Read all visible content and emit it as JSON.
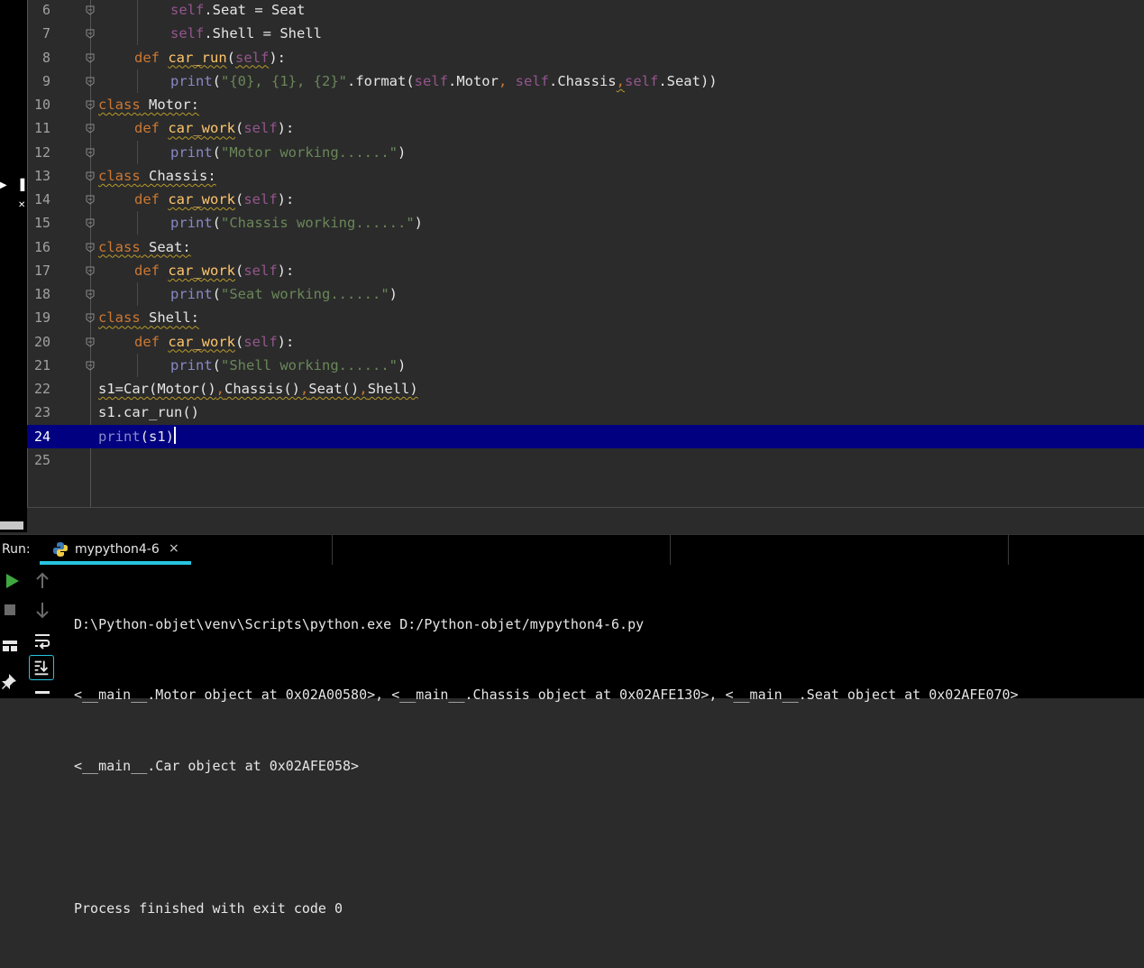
{
  "editor": {
    "current_line": 24,
    "lines": [
      {
        "n": "6",
        "tokens": [
          [
            "self",
            "self"
          ],
          [
            "",
            "."
          ],
          [
            "",
            "Seat = Seat"
          ]
        ]
      },
      {
        "n": "7",
        "tokens": [
          [
            "self",
            "self"
          ],
          [
            "",
            "."
          ],
          [
            "",
            "Shell = Shell"
          ]
        ]
      },
      {
        "n": "8",
        "tokens": [
          [
            "kw",
            "def "
          ],
          [
            "fn sq",
            "car_run"
          ],
          [
            "",
            "("
          ],
          [
            "self sq",
            "self"
          ],
          [
            "",
            "):"
          ]
        ]
      },
      {
        "n": "9",
        "tokens": [
          [
            "bi",
            "print"
          ],
          [
            "",
            "("
          ],
          [
            "str",
            "\"{0}, {1}, {2}\""
          ],
          [
            "",
            ".format("
          ],
          [
            "self",
            "self"
          ],
          [
            "",
            ".Motor"
          ],
          [
            "kw",
            ", "
          ],
          [
            "self",
            "self"
          ],
          [
            "",
            ".Chassis"
          ],
          [
            "kw sq",
            ","
          ],
          [
            "self",
            "self"
          ],
          [
            "",
            ".Seat))"
          ]
        ]
      },
      {
        "n": "10",
        "tokens": [
          [
            "kw sq",
            "class"
          ],
          [
            "sq",
            " Motor:"
          ]
        ]
      },
      {
        "n": "11",
        "tokens": [
          [
            "kw",
            "def "
          ],
          [
            "fn sq",
            "car_work"
          ],
          [
            "",
            "("
          ],
          [
            "self",
            "self"
          ],
          [
            "",
            "):"
          ]
        ]
      },
      {
        "n": "12",
        "tokens": [
          [
            "bi",
            "print"
          ],
          [
            "",
            "("
          ],
          [
            "str",
            "\"Motor working......\""
          ],
          [
            "",
            ")"
          ]
        ]
      },
      {
        "n": "13",
        "tokens": [
          [
            "kw sq",
            "class"
          ],
          [
            "sq",
            " Chassis:"
          ]
        ]
      },
      {
        "n": "14",
        "tokens": [
          [
            "kw",
            "def "
          ],
          [
            "fn sq",
            "car_work"
          ],
          [
            "",
            "("
          ],
          [
            "self",
            "self"
          ],
          [
            "",
            "):"
          ]
        ]
      },
      {
        "n": "15",
        "tokens": [
          [
            "bi",
            "print"
          ],
          [
            "",
            "("
          ],
          [
            "str",
            "\"Chassis working......\""
          ],
          [
            "",
            ")"
          ]
        ]
      },
      {
        "n": "16",
        "tokens": [
          [
            "kw sq",
            "class"
          ],
          [
            "sq",
            " Seat:"
          ]
        ]
      },
      {
        "n": "17",
        "tokens": [
          [
            "kw",
            "def "
          ],
          [
            "fn sq",
            "car_work"
          ],
          [
            "",
            "("
          ],
          [
            "self",
            "self"
          ],
          [
            "",
            "):"
          ]
        ]
      },
      {
        "n": "18",
        "tokens": [
          [
            "bi",
            "print"
          ],
          [
            "",
            "("
          ],
          [
            "str",
            "\"Seat working......\""
          ],
          [
            "",
            ")"
          ]
        ]
      },
      {
        "n": "19",
        "tokens": [
          [
            "kw sq",
            "class"
          ],
          [
            "sq",
            " Shell:"
          ]
        ]
      },
      {
        "n": "20",
        "tokens": [
          [
            "kw",
            "def "
          ],
          [
            "fn sq",
            "car_work"
          ],
          [
            "",
            "("
          ],
          [
            "self",
            "self"
          ],
          [
            "",
            "):"
          ]
        ]
      },
      {
        "n": "21",
        "tokens": [
          [
            "bi",
            "print"
          ],
          [
            "",
            "("
          ],
          [
            "str",
            "\"Shell working......\""
          ],
          [
            "",
            ")"
          ]
        ]
      },
      {
        "n": "22",
        "tokens": [
          [
            "sq",
            "s1=Car(Motor()"
          ],
          [
            "kw sq",
            ","
          ],
          [
            "sq",
            "Chassis()"
          ],
          [
            "kw sq",
            ","
          ],
          [
            "sq",
            "Seat()"
          ],
          [
            "kw sq",
            ","
          ],
          [
            "sq",
            "Shell)"
          ]
        ]
      },
      {
        "n": "23",
        "tokens": [
          [
            "",
            "s1.car_run()"
          ]
        ]
      },
      {
        "n": "24",
        "tokens": [
          [
            "bi",
            "print"
          ],
          [
            "",
            "(s1)"
          ]
        ]
      },
      {
        "n": "25",
        "tokens": []
      }
    ]
  },
  "run_panel": {
    "label": "Run:",
    "tab_label": "mypython4-6",
    "tab_close": "×"
  },
  "console": {
    "lines": [
      "D:\\Python-objet\\venv\\Scripts\\python.exe D:/Python-objet/mypython4-6.py",
      "<__main__.Motor object at 0x02A00580>, <__main__.Chassis object at 0x02AFE130>, <__main__.Seat object at 0x02AFE070>",
      "<__main__.Car object at 0x02AFE058>",
      "",
      "Process finished with exit code 0"
    ]
  },
  "icons": {
    "run": "run-triangle-icon",
    "stop": "stop-square-icon",
    "up": "arrow-up-icon",
    "down": "arrow-down-icon",
    "wrap": "soft-wrap-icon",
    "scroll": "scroll-to-end-icon",
    "layout": "layout-icon",
    "pin": "pin-icon",
    "python": "python-icon"
  },
  "colors": {
    "keyword": "#cc7832",
    "self": "#94558d",
    "function": "#ffc66d",
    "builtin": "#8888c6",
    "string": "#6a8759",
    "current_line": "#000080",
    "tab_accent": "#28c4e0"
  }
}
